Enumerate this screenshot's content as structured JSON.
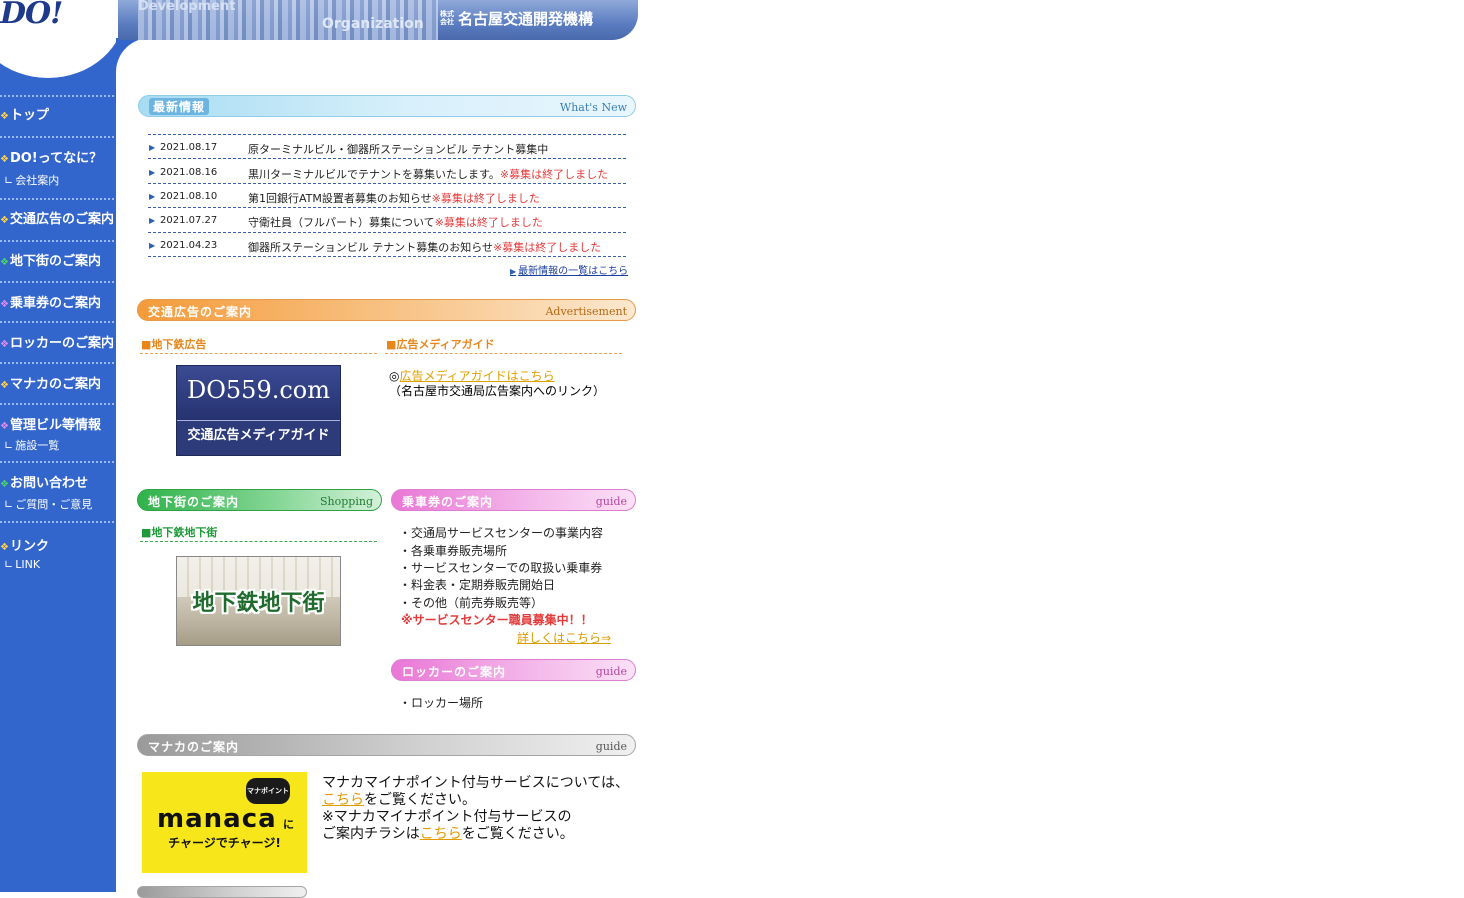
{
  "logo": {
    "text": "DO!"
  },
  "header": {
    "bg_word_1": "Development",
    "bg_word_2": "Organization",
    "company_prefix": "株式会社",
    "company_name": "名古屋交通開発機構"
  },
  "sidebar": {
    "items": [
      {
        "label": "トップ"
      },
      {
        "label": "DO!ってなに？",
        "sub": "会社案内"
      },
      {
        "label": "交通広告のご案内"
      },
      {
        "label": "地下街のご案内"
      },
      {
        "label": "乗車券のご案内"
      },
      {
        "label": "ロッカーのご案内"
      },
      {
        "label": "マナカのご案内"
      },
      {
        "label": "管理ビル等情報",
        "sub": "施設一覧"
      },
      {
        "label": "お問い合わせ",
        "sub": "ご質問・ご意見"
      },
      {
        "label": "リンク",
        "sub": "LINK"
      }
    ],
    "sub_prefix": "∟"
  },
  "news": {
    "heading_ja": "最新情報",
    "heading_en": "What's New",
    "items": [
      {
        "date": "2021.08.17",
        "title": "原ターミナルビル・御器所ステーションビル テナント募集中",
        "status": ""
      },
      {
        "date": "2021.08.16",
        "title": "黒川ターミナルビルでテナントを募集いたします。",
        "status": "※募集は終了しました"
      },
      {
        "date": "2021.08.10",
        "title": "第1回銀行ATM設置者募集のお知らせ",
        "status": "※募集は終了しました"
      },
      {
        "date": "2021.07.27",
        "title": "守衛社員（フルパート）募集について",
        "status": "※募集は終了しました"
      },
      {
        "date": "2021.04.23",
        "title": "御器所ステーションビル テナント募集のお知らせ",
        "status": "※募集は終了しました"
      }
    ],
    "more_link": "最新情報の一覧はこちら"
  },
  "advertisement": {
    "heading_ja": "交通広告のご案内",
    "heading_en": "Advertisement",
    "subway_heading": "■地下鉄広告",
    "media_heading": "■広告メディアガイド",
    "ad_image_domain": "DO559.com",
    "ad_image_label": "交通広告メディアガイド",
    "media_link_prefix": "◎",
    "media_link": "広告メディアガイドはこちら",
    "media_note": "（名古屋市交通局広告案内へのリンク）"
  },
  "shopping": {
    "heading_ja": "地下街のご案内",
    "heading_en": "Shopping",
    "subheading": "■地下鉄地下街",
    "image_label": "地下鉄地下街"
  },
  "tickets": {
    "heading_ja": "乗車券のご案内",
    "heading_en": "guide",
    "items": [
      "・交通局サービスセンターの事業内容",
      "・各乗車券販売場所",
      "・サービスセンターでの取扱い乗車券",
      "・料金表・定期券販売開始日",
      "・その他（前売券販売等）"
    ],
    "recruit": "※サービスセンター職員募集中！！",
    "detail_link": "詳しくはこちら⇒"
  },
  "lockers": {
    "heading_ja": "ロッカーのご案内",
    "heading_en": "guide",
    "items": [
      "・ロッカー場所"
    ]
  },
  "manaca": {
    "heading_ja": "マナカのご案内",
    "heading_en": "guide",
    "image_badge": "マナポイント",
    "image_logo": "manaca",
    "image_ni": "に",
    "image_charge": "チャージでチャージ!",
    "line1": "マナカマイナポイント付与サービスについては、",
    "line2_link": "こちら",
    "line2_rest": "をご覧ください。",
    "line3": "※マナカマイナポイント付与サービスの",
    "line4_prefix": "ご案内チラシは",
    "line4_link": "こちら",
    "line4_rest": "をご覧ください。"
  },
  "colors": {
    "sidebar": "#3366cc",
    "news_ended": "#e33b3b",
    "link_gold": "#e09a00",
    "manaca_yellow": "#f6e61a"
  }
}
